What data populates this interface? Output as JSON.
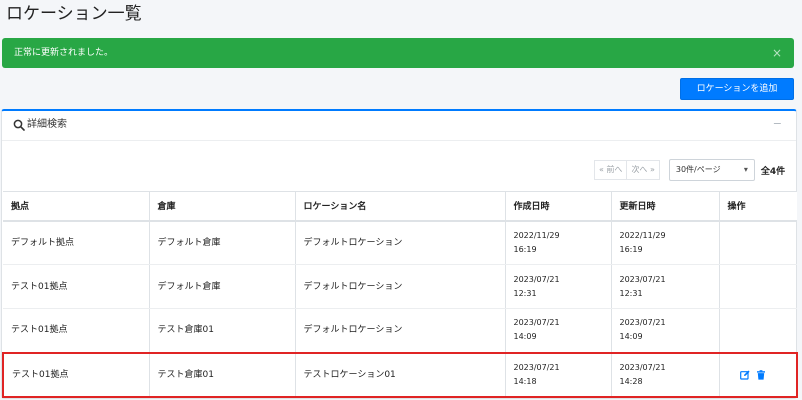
{
  "page": {
    "title": "ロケーション一覧"
  },
  "alert": {
    "message": "正常に更新されました。",
    "close": "×"
  },
  "toolbar": {
    "add_label": "ロケーションを追加"
  },
  "search": {
    "title": "詳細検索",
    "collapse": "−"
  },
  "pager": {
    "prev": "« 前へ",
    "next": "次へ »",
    "per_page": "30件/ページ",
    "total": "全4件"
  },
  "table": {
    "headers": {
      "base": "拠点",
      "warehouse": "倉庫",
      "location": "ロケーション名",
      "created": "作成日時",
      "updated": "更新日時",
      "ops": "操作"
    },
    "rows": [
      {
        "base": "デフォルト拠点",
        "warehouse": "デフォルト倉庫",
        "location": "デフォルトロケーション",
        "created_date": "2022/11/29",
        "created_time": "16:19",
        "updated_date": "2022/11/29",
        "updated_time": "16:19"
      },
      {
        "base": "テスト01拠点",
        "warehouse": "デフォルト倉庫",
        "location": "デフォルトロケーション",
        "created_date": "2023/07/21",
        "created_time": "12:31",
        "updated_date": "2023/07/21",
        "updated_time": "12:31"
      },
      {
        "base": "テスト01拠点",
        "warehouse": "テスト倉庫01",
        "location": "デフォルトロケーション",
        "created_date": "2023/07/21",
        "created_time": "14:09",
        "updated_date": "2023/07/21",
        "updated_time": "14:09"
      },
      {
        "base": "テスト01拠点",
        "warehouse": "テスト倉庫01",
        "location": "テストロケーション01",
        "created_date": "2023/07/21",
        "created_time": "14:18",
        "updated_date": "2023/07/21",
        "updated_time": "14:28"
      }
    ]
  },
  "colors": {
    "primary": "#007bff",
    "success": "#28a745",
    "highlight": "#e02424"
  },
  "icons": {
    "search": "search-icon",
    "edit": "edit-icon",
    "delete": "trash-icon"
  }
}
